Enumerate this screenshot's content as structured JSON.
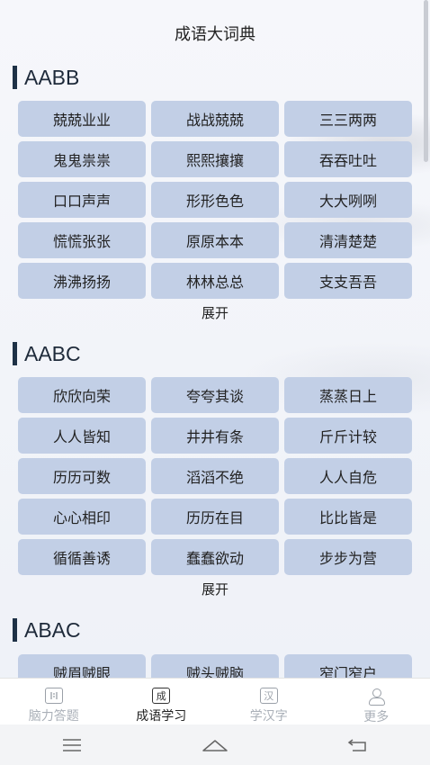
{
  "header": {
    "title": "成语大词典"
  },
  "sections": [
    {
      "name": "AABB",
      "items": [
        "兢兢业业",
        "战战兢兢",
        "三三两两",
        "鬼鬼祟祟",
        "熙熙攘攘",
        "吞吞吐吐",
        "口口声声",
        "形形色色",
        "大大咧咧",
        "慌慌张张",
        "原原本本",
        "清清楚楚",
        "沸沸扬扬",
        "林林总总",
        "支支吾吾"
      ],
      "expand_label": "展开"
    },
    {
      "name": "AABC",
      "items": [
        "欣欣向荣",
        "夸夸其谈",
        "蒸蒸日上",
        "人人皆知",
        "井井有条",
        "斤斤计较",
        "历历可数",
        "滔滔不绝",
        "人人自危",
        "心心相印",
        "历历在目",
        "比比皆是",
        "循循善诱",
        "蠢蠢欲动",
        "步步为营"
      ],
      "expand_label": "展开"
    },
    {
      "name": "ABAC",
      "items": [
        "贼眉贼眼",
        "贼头贼脑",
        "窄门窄户"
      ]
    }
  ],
  "tabbar": {
    "tabs": [
      {
        "label": "脑力答题",
        "icon": "quiz-icon",
        "glyph": "",
        "active": false
      },
      {
        "label": "成语学习",
        "icon": "idiom-icon",
        "glyph": "成",
        "active": true
      },
      {
        "label": "学汉字",
        "icon": "hanzi-icon",
        "glyph": "汉",
        "active": false
      },
      {
        "label": "更多",
        "icon": "person-icon",
        "glyph": "",
        "active": false
      }
    ]
  },
  "navbar": {
    "buttons": [
      "menu-icon",
      "home-icon",
      "back-icon"
    ]
  }
}
